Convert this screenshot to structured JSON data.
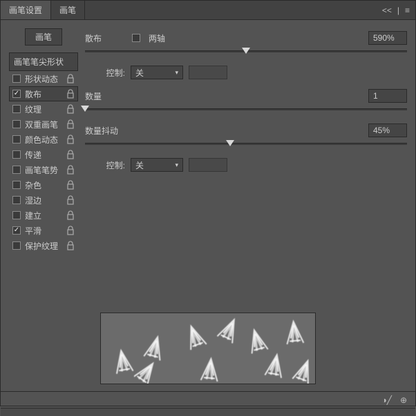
{
  "tabs": {
    "settings": "画笔设置",
    "brush": "画笔"
  },
  "brushButton": "画笔",
  "tipShape": "画笔笔尖形状",
  "options": [
    {
      "label": "形状动态",
      "checked": false,
      "selected": false,
      "lock": true
    },
    {
      "label": "散布",
      "checked": true,
      "selected": true,
      "lock": true
    },
    {
      "label": "纹理",
      "checked": false,
      "selected": false,
      "lock": true
    },
    {
      "label": "双重画笔",
      "checked": false,
      "selected": false,
      "lock": true
    },
    {
      "label": "颜色动态",
      "checked": false,
      "selected": false,
      "lock": true
    },
    {
      "label": "传递",
      "checked": false,
      "selected": false,
      "lock": true
    },
    {
      "label": "画笔笔势",
      "checked": false,
      "selected": false,
      "lock": true
    },
    {
      "label": "杂色",
      "checked": false,
      "selected": false,
      "lock": true
    },
    {
      "label": "湿边",
      "checked": false,
      "selected": false,
      "lock": true
    },
    {
      "label": "建立",
      "checked": false,
      "selected": false,
      "lock": true
    },
    {
      "label": "平滑",
      "checked": true,
      "selected": false,
      "lock": true
    },
    {
      "label": "保护纹理",
      "checked": false,
      "selected": false,
      "lock": true
    }
  ],
  "scatter": {
    "label": "散布",
    "bothAxes": "两轴",
    "bothAxesChecked": false,
    "value": "590%",
    "knob": 50,
    "controlLabel": "控制:",
    "controlValue": "关"
  },
  "count": {
    "label": "数量",
    "value": "1",
    "knob": 0
  },
  "countJitter": {
    "label": "数量抖动",
    "value": "45%",
    "knob": 45,
    "controlLabel": "控制:",
    "controlValue": "关"
  }
}
